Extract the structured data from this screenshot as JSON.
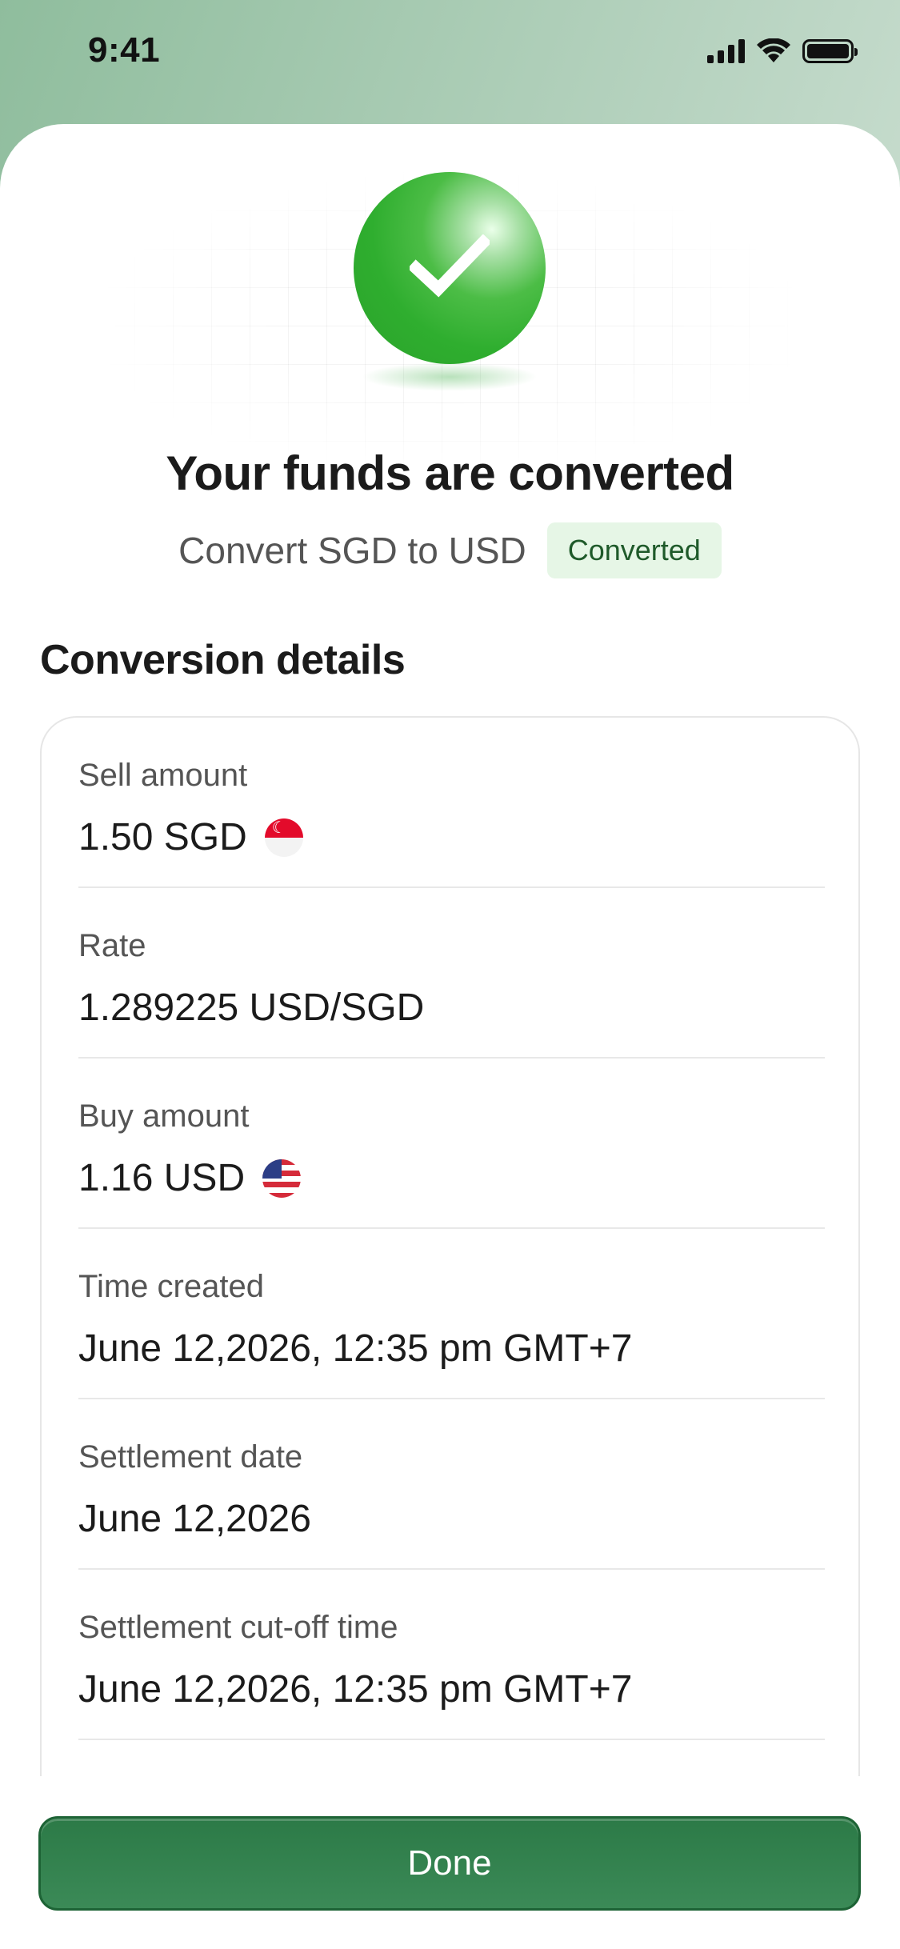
{
  "status_bar": {
    "time": "9:41"
  },
  "success": {
    "title": "Your funds are converted",
    "subtitle": "Convert SGD to USD",
    "badge": "Converted"
  },
  "details": {
    "section_title": "Conversion details",
    "rows": [
      {
        "label": "Sell amount",
        "value": "1.50 SGD",
        "flag": "singapore-flag"
      },
      {
        "label": "Rate",
        "value": "1.289225 USD/SGD"
      },
      {
        "label": "Buy amount",
        "value": "1.16 USD",
        "flag": "us-flag"
      },
      {
        "label": "Time created",
        "value": "June 12,2026, 12:35 pm GMT+7"
      },
      {
        "label": "Settlement date",
        "value": "June 12,2026"
      },
      {
        "label": "Settlement cut-off time",
        "value": "June 12,2026, 12:35 pm GMT+7"
      }
    ]
  },
  "actions": {
    "done_label": "Done"
  },
  "colors": {
    "accent": "#2c7a47",
    "success": "#2fae2f",
    "badge_bg": "#e6f6e6",
    "badge_text": "#1f5a2a"
  }
}
